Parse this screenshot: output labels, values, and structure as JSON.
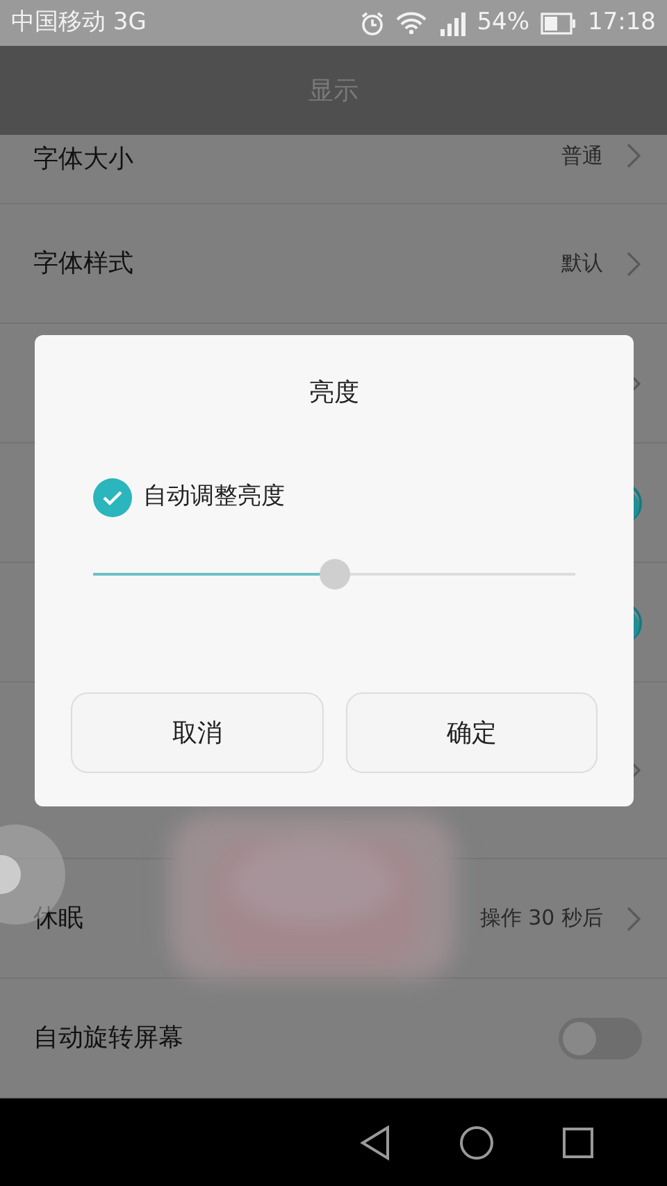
{
  "status_bar": {
    "carrier": "中国移动 3G",
    "battery": "54%",
    "time": "17:18"
  },
  "header": {
    "title": "显示"
  },
  "settings": [
    {
      "kind": "link",
      "label": "字体大小",
      "value": "普通"
    },
    {
      "kind": "link",
      "label": "字体样式",
      "value": "默认"
    },
    {
      "kind": "link"
    },
    {
      "kind": "switch",
      "on": true
    },
    {
      "kind": "switch",
      "on": true
    },
    {
      "kind": "link"
    },
    {
      "kind": "link",
      "label": "休眠",
      "value": "操作 30 秒后"
    },
    {
      "kind": "switch",
      "label": "自动旋转屏幕",
      "on": false
    }
  ],
  "dialog": {
    "title": "亮度",
    "auto": {
      "label": "自动调整亮度",
      "checked": true
    },
    "brightness": {
      "level": 0.5
    },
    "buttons": [
      "取消",
      "确定"
    ]
  }
}
